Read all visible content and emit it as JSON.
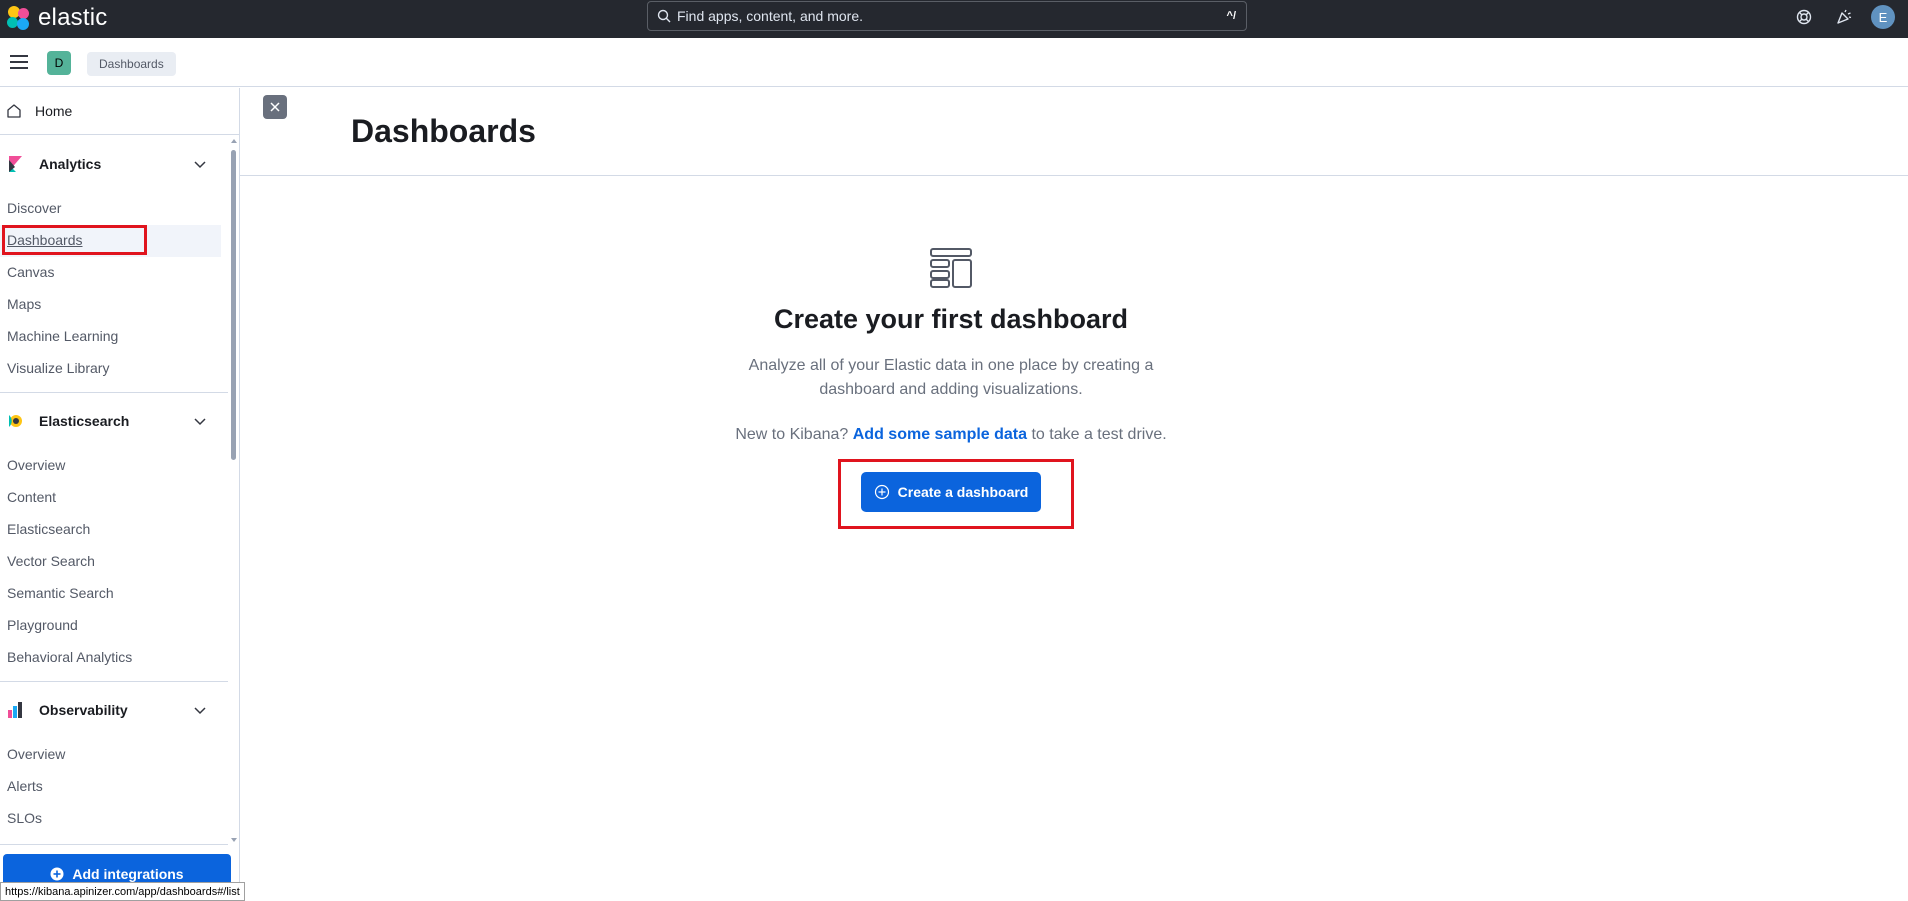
{
  "header": {
    "logo_text": "elastic",
    "search_placeholder": "Find apps, content, and more.",
    "search_shortcut": "^/",
    "avatar_initial": "E"
  },
  "subheader": {
    "space_initial": "D",
    "breadcrumb": "Dashboards"
  },
  "sidebar": {
    "home": "Home",
    "groups": [
      {
        "label": "Analytics",
        "items": [
          "Discover",
          "Dashboards",
          "Canvas",
          "Maps",
          "Machine Learning",
          "Visualize Library"
        ]
      },
      {
        "label": "Elasticsearch",
        "items": [
          "Overview",
          "Content",
          "Elasticsearch",
          "Vector Search",
          "Semantic Search",
          "Playground",
          "Behavioral Analytics"
        ]
      },
      {
        "label": "Observability",
        "items": [
          "Overview",
          "Alerts",
          "SLOs"
        ]
      }
    ],
    "active_item": "Dashboards",
    "add_integrations": "Add integrations"
  },
  "main": {
    "title": "Dashboards",
    "empty_title": "Create your first dashboard",
    "empty_body": "Analyze all of your Elastic data in one place by creating a dashboard and adding visualizations.",
    "sample_prefix": "New to Kibana?",
    "sample_link": "Add some sample data",
    "sample_suffix": "to take a test drive.",
    "create_button": "Create a dashboard"
  },
  "status_url": "https://kibana.apinizer.com/app/dashboards#/list",
  "colors": {
    "header_bg": "#25282f",
    "primary": "#0b64dd",
    "highlight_box": "#e0141e"
  }
}
